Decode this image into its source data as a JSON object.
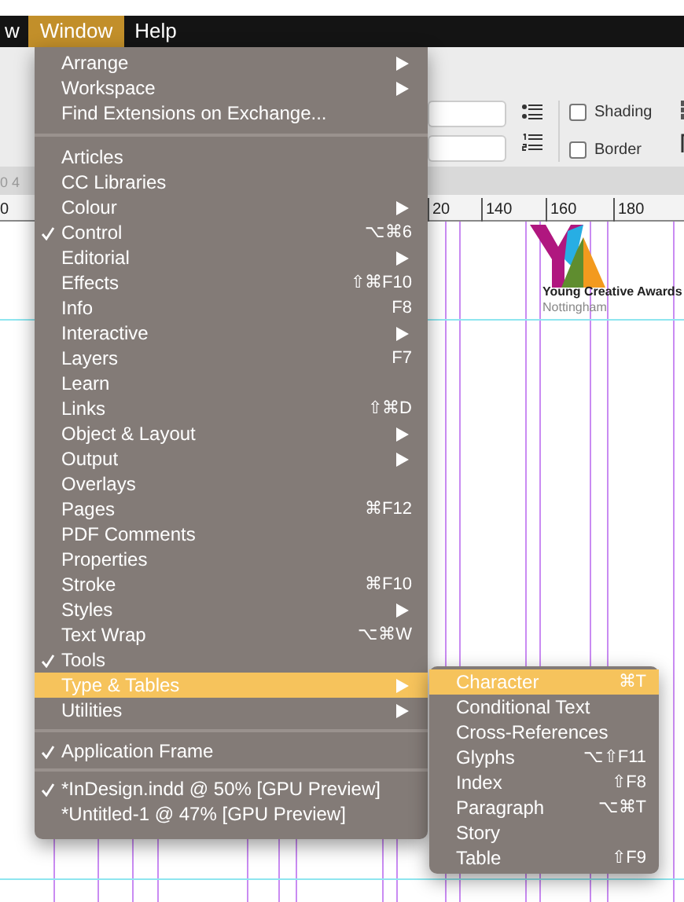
{
  "menubar": [
    {
      "label": "w",
      "selected": false
    },
    {
      "label": "Window",
      "selected": true
    },
    {
      "label": "Help",
      "selected": false
    }
  ],
  "toolbar": {
    "checkboxes": [
      {
        "label": "Shading",
        "checked": false
      },
      {
        "label": "Border",
        "checked": false
      }
    ]
  },
  "ruler": {
    "left_fragments": [
      "0 4",
      "0"
    ],
    "labels": [
      "20",
      "140",
      "160",
      "180"
    ]
  },
  "logo": {
    "title": "Young Creative Awards",
    "subtitle": "Nottingham"
  },
  "menu": {
    "sections": [
      [
        {
          "label": "Arrange",
          "checked": false,
          "submenu": true,
          "selected": false
        },
        {
          "label": "Workspace",
          "checked": false,
          "submenu": true,
          "selected": false
        },
        {
          "label": "Find Extensions on Exchange...",
          "checked": false,
          "submenu": false,
          "selected": false
        }
      ],
      [
        {
          "label": "Articles",
          "checked": false,
          "submenu": false,
          "selected": false
        },
        {
          "label": "CC Libraries",
          "checked": false,
          "submenu": false,
          "selected": false
        },
        {
          "label": "Colour",
          "checked": false,
          "submenu": true,
          "selected": false
        },
        {
          "label": "Control",
          "checked": true,
          "shortcut": "⌥⌘6",
          "submenu": false,
          "selected": false
        },
        {
          "label": "Editorial",
          "checked": false,
          "submenu": true,
          "selected": false
        },
        {
          "label": "Effects",
          "checked": false,
          "shortcut": "⇧⌘F10",
          "submenu": false,
          "selected": false
        },
        {
          "label": "Info",
          "checked": false,
          "shortcut": "F8",
          "submenu": false,
          "selected": false
        },
        {
          "label": "Interactive",
          "checked": false,
          "submenu": true,
          "selected": false
        },
        {
          "label": "Layers",
          "checked": false,
          "shortcut": "F7",
          "submenu": false,
          "selected": false
        },
        {
          "label": "Learn",
          "checked": false,
          "submenu": false,
          "selected": false
        },
        {
          "label": "Links",
          "checked": false,
          "shortcut": "⇧⌘D",
          "submenu": false,
          "selected": false
        },
        {
          "label": "Object & Layout",
          "checked": false,
          "submenu": true,
          "selected": false
        },
        {
          "label": "Output",
          "checked": false,
          "submenu": true,
          "selected": false
        },
        {
          "label": "Overlays",
          "checked": false,
          "submenu": false,
          "selected": false
        },
        {
          "label": "Pages",
          "checked": false,
          "shortcut": "⌘F12",
          "submenu": false,
          "selected": false
        },
        {
          "label": "PDF Comments",
          "checked": false,
          "submenu": false,
          "selected": false
        },
        {
          "label": "Properties",
          "checked": false,
          "submenu": false,
          "selected": false
        },
        {
          "label": "Stroke",
          "checked": false,
          "shortcut": "⌘F10",
          "submenu": false,
          "selected": false
        },
        {
          "label": "Styles",
          "checked": false,
          "submenu": true,
          "selected": false
        },
        {
          "label": "Text Wrap",
          "checked": false,
          "shortcut": "⌥⌘W",
          "submenu": false,
          "selected": false
        },
        {
          "label": "Tools",
          "checked": true,
          "submenu": false,
          "selected": false
        },
        {
          "label": "Type & Tables",
          "checked": false,
          "submenu": true,
          "selected": true
        },
        {
          "label": "Utilities",
          "checked": false,
          "submenu": true,
          "selected": false
        }
      ],
      [
        {
          "label": "Application Frame",
          "checked": true,
          "submenu": false,
          "selected": false
        }
      ],
      [
        {
          "label": "*InDesign.indd @ 50% [GPU Preview]",
          "checked": true,
          "submenu": false,
          "selected": false
        },
        {
          "label": "*Untitled-1 @ 47% [GPU Preview]",
          "checked": false,
          "submenu": false,
          "selected": false
        }
      ]
    ]
  },
  "submenu": {
    "items": [
      {
        "label": "Character",
        "shortcut": "⌘T",
        "selected": true
      },
      {
        "label": "Conditional Text",
        "selected": false
      },
      {
        "label": "Cross-References",
        "selected": false
      },
      {
        "label": "Glyphs",
        "shortcut": "⌥⇧F11",
        "selected": false
      },
      {
        "label": "Index",
        "shortcut": "⇧F8",
        "selected": false
      },
      {
        "label": "Paragraph",
        "shortcut": "⌥⌘T",
        "selected": false
      },
      {
        "label": "Story",
        "selected": false
      },
      {
        "label": "Table",
        "shortcut": "⇧F9",
        "selected": false
      }
    ]
  }
}
